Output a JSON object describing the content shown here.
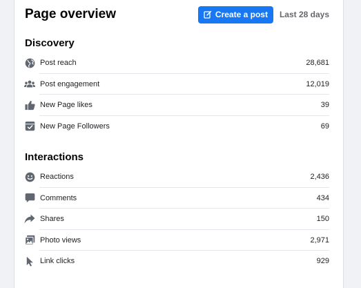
{
  "header": {
    "title": "Page overview",
    "create_post_label": "Create a post",
    "date_range": "Last 28 days"
  },
  "discovery": {
    "title": "Discovery",
    "rows": [
      {
        "label": "Post reach",
        "value": "28,681",
        "icon": "globe-icon"
      },
      {
        "label": "Post engagement",
        "value": "12,019",
        "icon": "people-icon"
      },
      {
        "label": "New Page likes",
        "value": "39",
        "icon": "thumbs-up-icon"
      },
      {
        "label": "New Page Followers",
        "value": "69",
        "icon": "follow-icon"
      }
    ]
  },
  "interactions": {
    "title": "Interactions",
    "rows": [
      {
        "label": "Reactions",
        "value": "2,436",
        "icon": "smiley-icon"
      },
      {
        "label": "Comments",
        "value": "434",
        "icon": "comment-icon"
      },
      {
        "label": "Shares",
        "value": "150",
        "icon": "share-icon"
      },
      {
        "label": "Photo views",
        "value": "2,971",
        "icon": "photo-icon"
      },
      {
        "label": "Link clicks",
        "value": "929",
        "icon": "cursor-icon"
      }
    ]
  },
  "colors": {
    "accent": "#1877f2",
    "icon": "#606770",
    "background": "#f0f2f5"
  }
}
